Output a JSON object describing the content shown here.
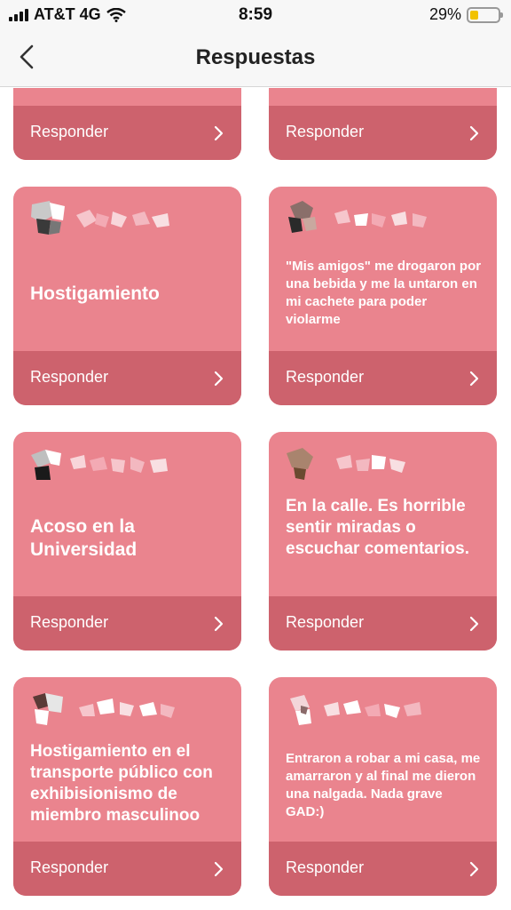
{
  "status_bar": {
    "carrier": "AT&T 4G",
    "time": "8:59",
    "battery": "29%",
    "battery_level": 0.29
  },
  "nav": {
    "title": "Respuestas",
    "back_icon": "chevron-left-icon"
  },
  "footer_label": "Responder",
  "cards": [
    {
      "id": "c1",
      "text": ""
    },
    {
      "id": "c2",
      "text": ""
    },
    {
      "id": "c3",
      "text": "Hostigamiento"
    },
    {
      "id": "c4",
      "text": "\"Mis amigos\" me drogaron por una bebida y me la untaron en mi cachete para poder violarme"
    },
    {
      "id": "c5",
      "text": "Acoso en la Universidad"
    },
    {
      "id": "c6",
      "text": "En la calle. Es horrible sentir miradas o escuchar comentarios."
    },
    {
      "id": "c7",
      "text": "Hostigamiento en el transporte público con exhibisionismo de miembro masculinoo"
    },
    {
      "id": "c8",
      "text": "Entraron a robar a mi casa, me amarraron y al final me dieron una nalgada. Nada grave GAD:)"
    }
  ],
  "colors": {
    "card": "#ea848e",
    "card_footer": "#cd626d",
    "nav_bg": "#f7f7f7"
  }
}
